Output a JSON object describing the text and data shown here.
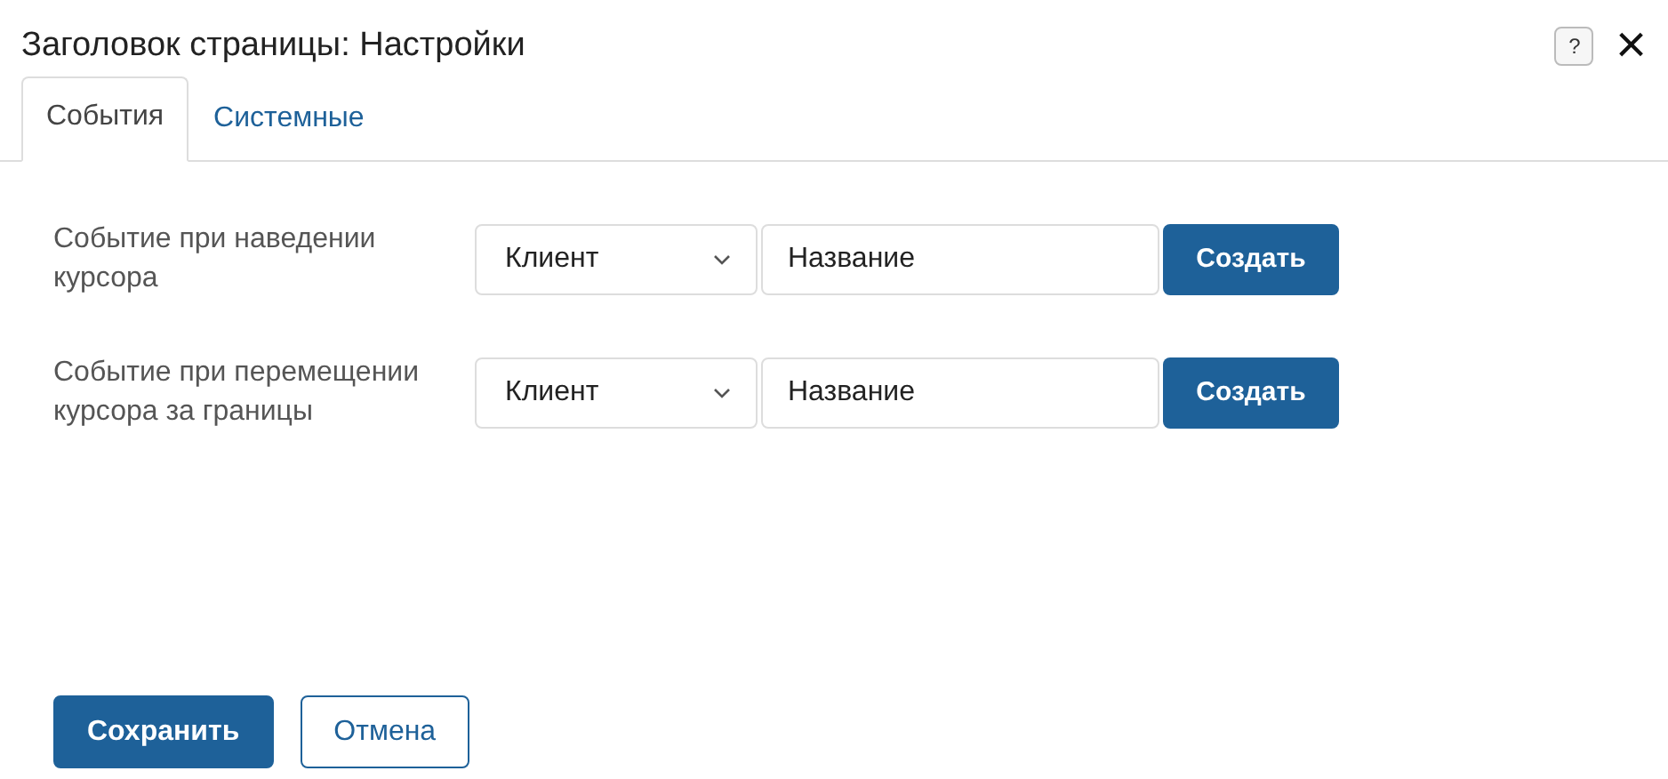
{
  "window": {
    "title": "Заголовок страницы: Настройки",
    "help_icon": "?",
    "close_icon": "×"
  },
  "tabs": [
    {
      "label": "События",
      "selected": true
    },
    {
      "label": "Системные",
      "selected": false
    }
  ],
  "events": [
    {
      "label": "Событие при наведении курсора",
      "select_value": "Клиент",
      "input_value": "Название",
      "button": "Создать"
    },
    {
      "label": "Событие при перемещении курсора за границы",
      "select_value": "Клиент",
      "input_value": "Название",
      "button": "Создать"
    }
  ],
  "footer_buttons": [
    {
      "label": "Сохранить",
      "kind": "primary"
    },
    {
      "label": "Отмена",
      "kind": "secondary"
    }
  ]
}
